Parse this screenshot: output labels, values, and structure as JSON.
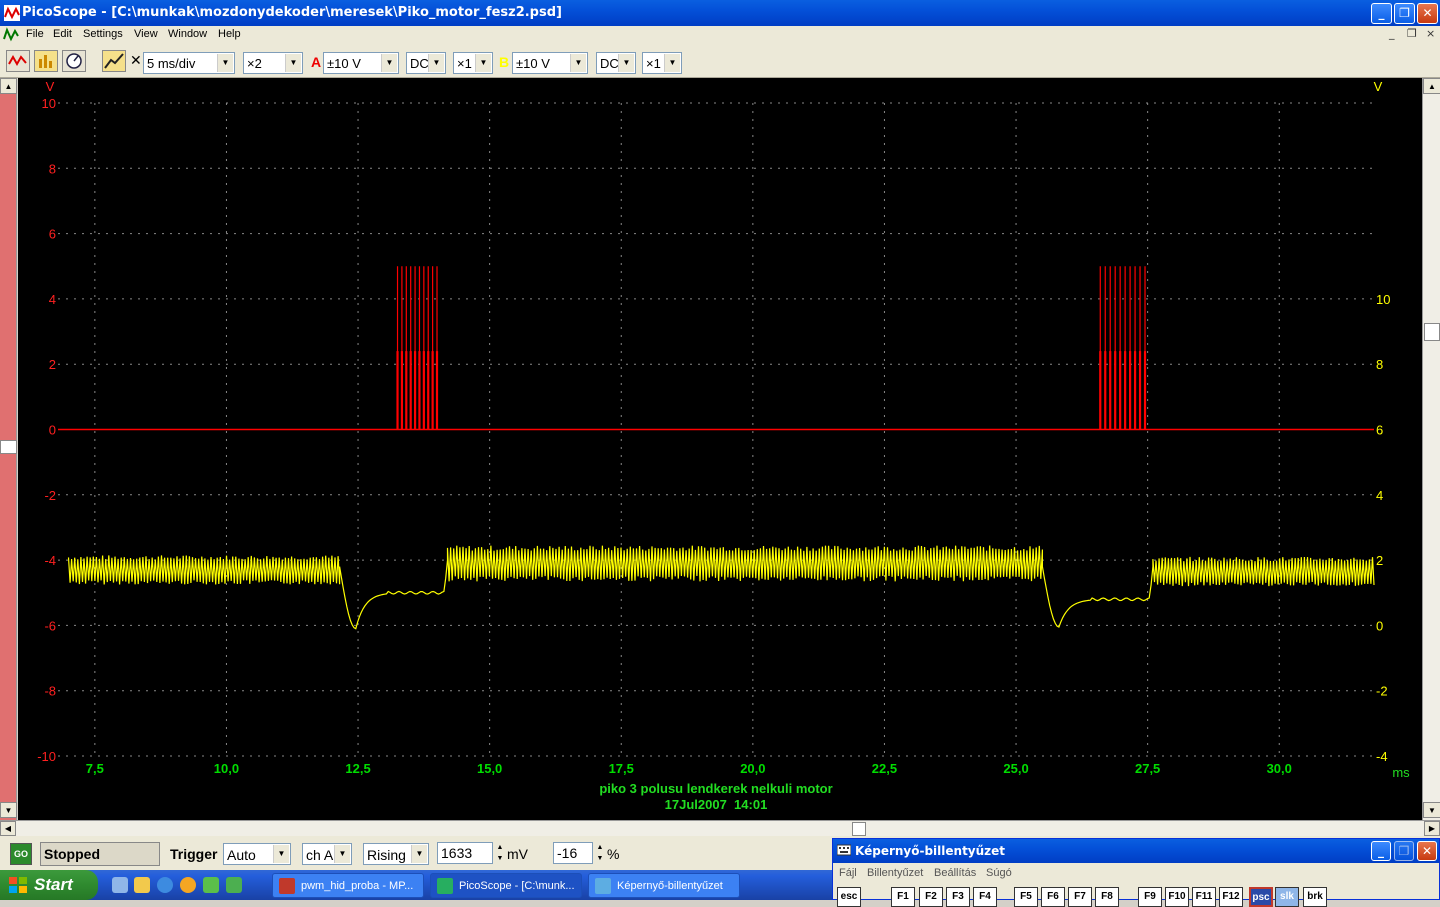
{
  "window": {
    "title": "PicoScope - [C:\\munkak\\mozdonydekoder\\meresek\\Piko_motor_fesz2.psd]",
    "minimize": "_",
    "maximize": "❐",
    "close": "✕"
  },
  "menu": {
    "items": [
      "File",
      "Edit",
      "Settings",
      "View",
      "Window",
      "Help"
    ],
    "mdi_controls": [
      "_",
      "❐",
      "×"
    ]
  },
  "toolbar": {
    "timebase": "5 ms/div",
    "zoom": "×2",
    "channel_a": {
      "label": "A",
      "range": "±10 V",
      "coupling": "DC",
      "probe": "×1"
    },
    "channel_b": {
      "label": "B",
      "range": "±10 V",
      "coupling": "DC",
      "probe": "×1"
    },
    "x_symbol": "✕"
  },
  "chart_data": {
    "type": "line",
    "xlabel": "ms",
    "x_ticks": [
      "7,5",
      "10,0",
      "12,5",
      "15,0",
      "17,5",
      "20,0",
      "22,5",
      "25,0",
      "27,5",
      "30,0"
    ],
    "xlim": [
      6.8,
      31.8
    ],
    "left_axis": {
      "unit": "V",
      "ticks": [
        "10",
        "8",
        "6",
        "4",
        "2",
        "0",
        "-2",
        "-4",
        "-6",
        "-8",
        "-10"
      ],
      "ylim": [
        -10,
        10
      ]
    },
    "right_axis": {
      "unit": "V",
      "ticks": [
        "10",
        "8",
        "6",
        "4",
        "2",
        "0",
        "-2",
        "-4"
      ],
      "ylim": [
        -4,
        16
      ]
    },
    "grid": true,
    "footer_title": "piko 3 polusu lendkerek nelkuli motor",
    "footer_date": "17Jul2007  14:01",
    "colors": {
      "channel_a": "#ff0000",
      "channel_b": "#ffff00",
      "axis_x": "#00dd00",
      "grid": "#888888"
    },
    "series": [
      {
        "name": "A",
        "baseline": 0,
        "pulse_bursts": [
          {
            "x_start": 13.25,
            "x_end": 14.0,
            "pulses": 10,
            "high": 5,
            "mid": 2.4
          },
          {
            "x_start": 26.6,
            "x_end": 27.45,
            "pulses": 10,
            "high": 5,
            "mid": 2.4
          }
        ]
      },
      {
        "name": "B",
        "segments": [
          {
            "kind": "ripple",
            "x_start": 7.0,
            "x_end": 12.15,
            "center": -4.3,
            "amplitude": 0.45
          },
          {
            "kind": "dip",
            "x_start": 12.15,
            "x_end": 14.2,
            "min": -6.1,
            "settle": -5.0
          },
          {
            "kind": "ripple",
            "x_start": 14.2,
            "x_end": 25.5,
            "center": -4.1,
            "amplitude": 0.55
          },
          {
            "kind": "dip",
            "x_start": 25.5,
            "x_end": 27.6,
            "min": -6.05,
            "settle": -5.2
          },
          {
            "kind": "ripple",
            "x_start": 27.6,
            "x_end": 31.8,
            "center": -4.35,
            "amplitude": 0.45
          }
        ]
      }
    ]
  },
  "status": {
    "go_label": "GO",
    "state": "Stopped",
    "trigger_label": "Trigger",
    "trigger_mode": "Auto",
    "trigger_channel": "ch A",
    "trigger_edge": "Rising",
    "trigger_level": "1633",
    "level_unit": "mV",
    "delay": "-16",
    "delay_unit": "%"
  },
  "taskbar": {
    "start": "Start",
    "tasks": [
      {
        "label": "pwm_hid_proba - MP...",
        "icon_color": "#c0392b"
      },
      {
        "label": "PicoScope - [C:\\munk...",
        "icon_color": "#27ae60"
      },
      {
        "label": "Képernyő-billentyűzet",
        "icon_color": "#5dade2"
      }
    ]
  },
  "keyboard": {
    "title": "Képernyő-billentyűzet",
    "menu": [
      "Fájl",
      "Billentyűzet",
      "Beállítás",
      "Súgó"
    ],
    "keys": [
      "esc",
      "F1",
      "F2",
      "F3",
      "F4",
      "F5",
      "F6",
      "F7",
      "F8",
      "F9",
      "F10",
      "F11",
      "F12",
      "psc",
      "slk",
      "brk"
    ]
  }
}
